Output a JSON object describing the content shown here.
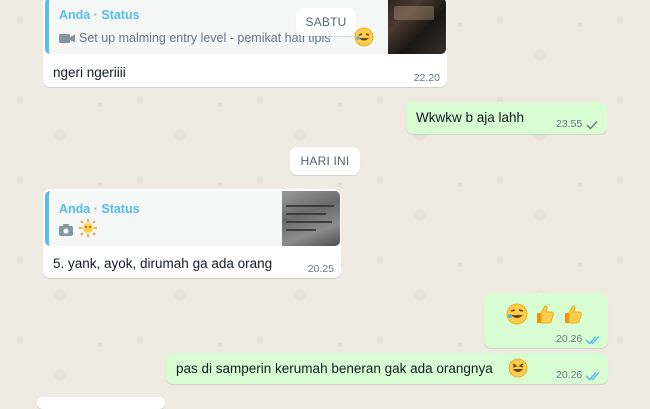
{
  "chat": {
    "date_label_1": "SABTU",
    "date_label_2": "HARI INI",
    "messages": [
      {
        "quote_name": "Anda · Status",
        "quote_text": "Set up malming entry level - pemikat hati tipis",
        "quote_icon": "video-camera-icon",
        "text": "ngeri ngeriiii",
        "time": "22.20"
      },
      {
        "text": "Wkwkw b aja lahh",
        "time": "23.55",
        "status": "sent-single-tick"
      },
      {
        "quote_name": "Anda · Status",
        "quote_icon": "camera-icon",
        "text": "5. yank, ayok, dirumah ga ada orang",
        "time": "20.25"
      },
      {
        "text": "",
        "emojis": [
          "rolling-on-floor-laughing",
          "thumbs-up",
          "thumbs-up"
        ],
        "time": "20.26",
        "status": "read-double-tick"
      },
      {
        "text": "pas di samperin kerumah beneran gak ada orangnya",
        "time": "20.26",
        "status": "read-double-tick"
      }
    ]
  },
  "colors": {
    "quote_accent": "#53bdeb",
    "read_tick": "#53bdeb",
    "outgoing_bg": "#d9fdd3",
    "incoming_bg": "#ffffff"
  }
}
